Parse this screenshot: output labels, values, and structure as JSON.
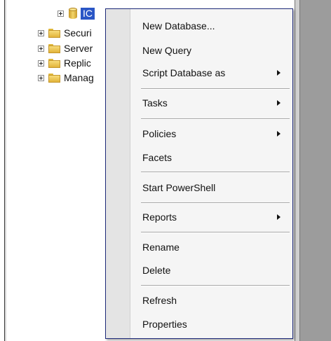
{
  "tree": {
    "nodes": [
      {
        "label": "IC",
        "type": "database"
      },
      {
        "label": "Securi",
        "type": "folder"
      },
      {
        "label": "Server",
        "type": "folder"
      },
      {
        "label": "Replic",
        "type": "folder"
      },
      {
        "label": "Manag",
        "type": "folder"
      }
    ]
  },
  "menu": {
    "items": [
      {
        "label": "New Database...",
        "submenu": false
      },
      {
        "label": "New Query",
        "submenu": false
      },
      {
        "label": "Script Database as",
        "submenu": true
      },
      {
        "label": "Tasks",
        "submenu": true
      },
      {
        "label": "Policies",
        "submenu": true
      },
      {
        "label": "Facets",
        "submenu": false
      },
      {
        "label": "Start PowerShell",
        "submenu": false
      },
      {
        "label": "Reports",
        "submenu": true
      },
      {
        "label": "Rename",
        "submenu": false
      },
      {
        "label": "Delete",
        "submenu": false
      },
      {
        "label": "Refresh",
        "submenu": false
      },
      {
        "label": "Properties",
        "submenu": false
      }
    ]
  },
  "colors": {
    "selection": "#2a56c6",
    "menu_border": "#1e2a7a",
    "folder": "#f0c850"
  }
}
